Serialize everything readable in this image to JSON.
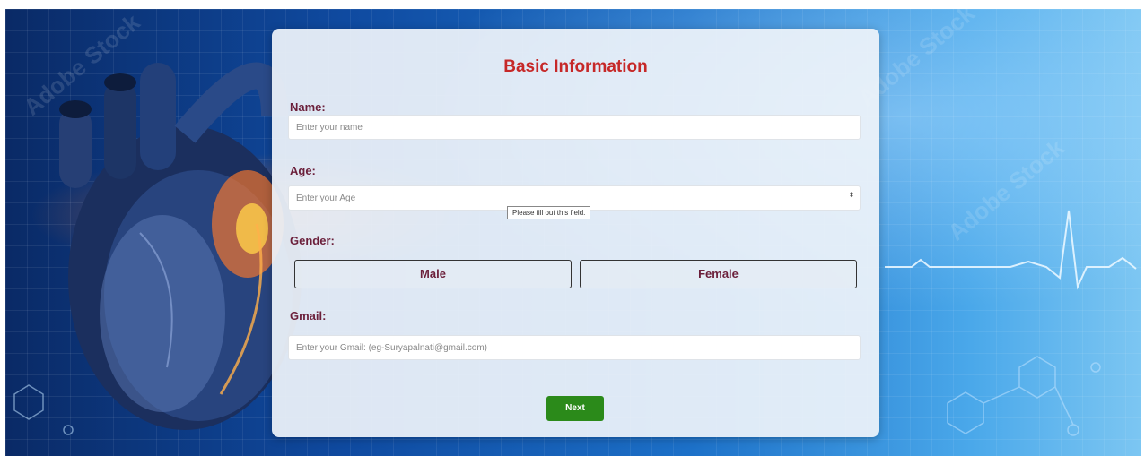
{
  "form": {
    "title": "Basic Information",
    "name": {
      "label": "Name:",
      "placeholder": "Enter your name"
    },
    "age": {
      "label": "Age:",
      "placeholder": "Enter your Age",
      "spinner_glyph": "⬍"
    },
    "validation_tooltip": "Please fill out this field.",
    "gender": {
      "label": "Gender:",
      "options": [
        "Male",
        "Female"
      ]
    },
    "gmail": {
      "label": "Gmail:",
      "placeholder": "Enter your Gmail: (eg-Suryapalnati@gmail.com)"
    },
    "next_label": "Next"
  },
  "colors": {
    "title": "#c62828",
    "label": "#6b1f3a",
    "next_button": "#2b8a1a"
  },
  "background": {
    "watermark": "Adobe Stock"
  }
}
